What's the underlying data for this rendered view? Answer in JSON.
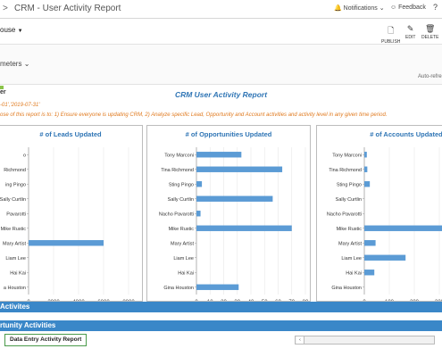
{
  "topbar": {
    "breadcrumb_glyph": ">",
    "title": "CRM - User Activity Report",
    "notifications": "Notifications",
    "feedback": "Feedback"
  },
  "toolbar": {
    "workspace_fragment": "ouse",
    "params_fragment": "meters",
    "auto_refresh_fragment": "Auto-refre",
    "publish": "PUBLISH",
    "edit": "EDIT",
    "delete": "DELETE"
  },
  "report": {
    "logo_fragment": "er",
    "title": "CRM User Activity Report",
    "dates_fragment": "-01','2019-07-31'",
    "purpose_fragment": "ose of this report is to: 1) Ensure everyone is updating CRM, 2) Analyze specific Lead, Opportunity and Account activities and activity level in any given time period."
  },
  "colors": {
    "accent": "#2f75b5",
    "bar": "#5b9bd5",
    "section": "#3a87c8",
    "warning_text": "#e07a1f"
  },
  "chart_data": [
    {
      "type": "bar",
      "title": "# of Leads Updated",
      "categories": [
        "Tony Marconi",
        "Tina Richmond",
        "Sting Pingo",
        "Sally Curtlin",
        "Nacho Pavarotti",
        "Mike Rustic",
        "Mary Artist",
        "Liam Lee",
        "Hai Kai",
        "Gina Houston"
      ],
      "display_labels": [
        "o",
        "Richmond",
        "ing Pingo",
        "Sally Curtlin",
        "Pavarotti",
        "Mike Rustic",
        "Mary Artist",
        "Liam Lee",
        "Hai Kai",
        "a Houston"
      ],
      "values": [
        0,
        0,
        0,
        0,
        0,
        0,
        6000,
        0,
        0,
        0
      ],
      "xlim": [
        0,
        8000
      ],
      "xticks": [
        "0",
        "2000",
        "4000",
        "6000",
        "8000"
      ]
    },
    {
      "type": "bar",
      "title": "# of Opportunities Updated",
      "categories": [
        "Tony Marconi",
        "Tina Richmond",
        "Sting Pingo",
        "Sally Curtlin",
        "Nacho Pavarotti",
        "Mike Rustic",
        "Mary Artist",
        "Liam Lee",
        "Hai Kai",
        "Gina Houston"
      ],
      "display_labels": [
        "Tony Marconi",
        "Tina Richmond",
        "Sting Pingo",
        "Sally Curtlin",
        "Nacho Pavarotti",
        "Mike Rustic",
        "Mary Artist",
        "Liam Lee",
        "Hai Kai",
        "Gina Houston"
      ],
      "values": [
        33,
        63,
        4,
        56,
        3,
        70,
        0,
        0,
        0,
        31
      ],
      "xlim": [
        0,
        80
      ],
      "xticks": [
        "0",
        "10",
        "20",
        "30",
        "40",
        "50",
        "60",
        "70",
        "80"
      ]
    },
    {
      "type": "bar",
      "title": "# of Accounts Updated",
      "categories": [
        "Tony Marconi",
        "Tina Richmond",
        "Sting Pingo",
        "Sally Curtlin",
        "Nacho Pavarotti",
        "Mike Rustic",
        "Mary Artist",
        "Liam Lee",
        "Hai Kai",
        "Gina Houston"
      ],
      "display_labels": [
        "Tony Marconi",
        "Tina Richmond",
        "Sting Pingo",
        "Sally Curtlin",
        "Nacho Pavarotti",
        "Mike Rustic",
        "Mary Artist",
        "Liam Lee",
        "Hai Kai",
        "Gina Houston"
      ],
      "values": [
        10,
        12,
        22,
        0,
        0,
        320,
        45,
        165,
        40,
        0
      ],
      "xlim": [
        0,
        300
      ],
      "xticks": [
        "0",
        "100",
        "200",
        "300"
      ]
    }
  ],
  "sections": {
    "account_fragment": "Activites",
    "opportunity_fragment": "rtunity Activities"
  },
  "tabs": {
    "active": "Data Entry Activity Report"
  }
}
